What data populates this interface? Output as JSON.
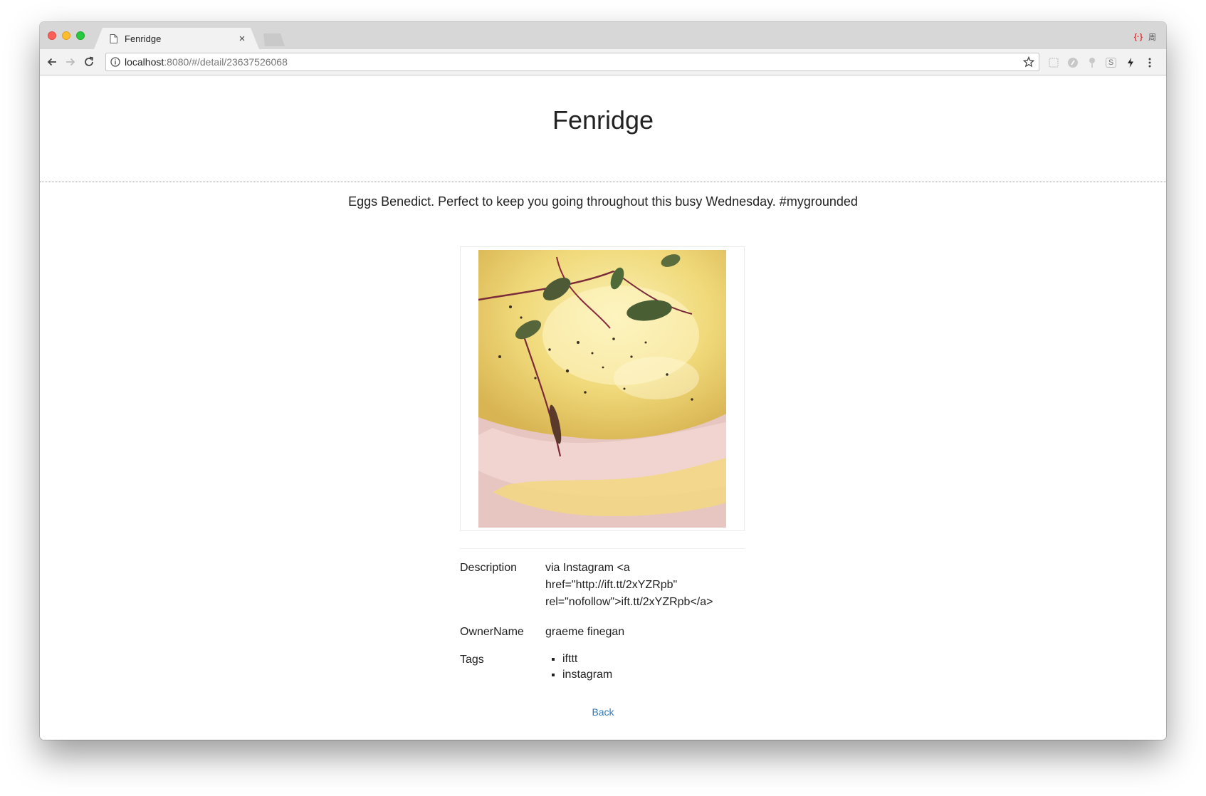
{
  "browser": {
    "tab_title": "Fenridge",
    "tab_close": "×",
    "url_host": "localhost",
    "url_rest": ":8080/#/detail/23637526068",
    "ext_red_label": "{·}",
    "ext_cjk_label": "周",
    "ext_s_label": "S"
  },
  "page": {
    "title": "Fenridge",
    "caption": "Eggs Benedict. Perfect to keep you going throughout this busy Wednesday. #mygrounded",
    "details": {
      "description_label": "Description",
      "description_value": "via Instagram <a href=\"http://ift.tt/2xYZRpb\" rel=\"nofollow\">ift.tt/2xYZRpb</a>",
      "owner_label": "OwnerName",
      "owner_value": "graeme finegan",
      "tags_label": "Tags",
      "tags": [
        "ifttt",
        "instagram"
      ]
    },
    "back_label": "Back"
  },
  "colors": {
    "link": "#337ab7",
    "text": "#222222"
  }
}
